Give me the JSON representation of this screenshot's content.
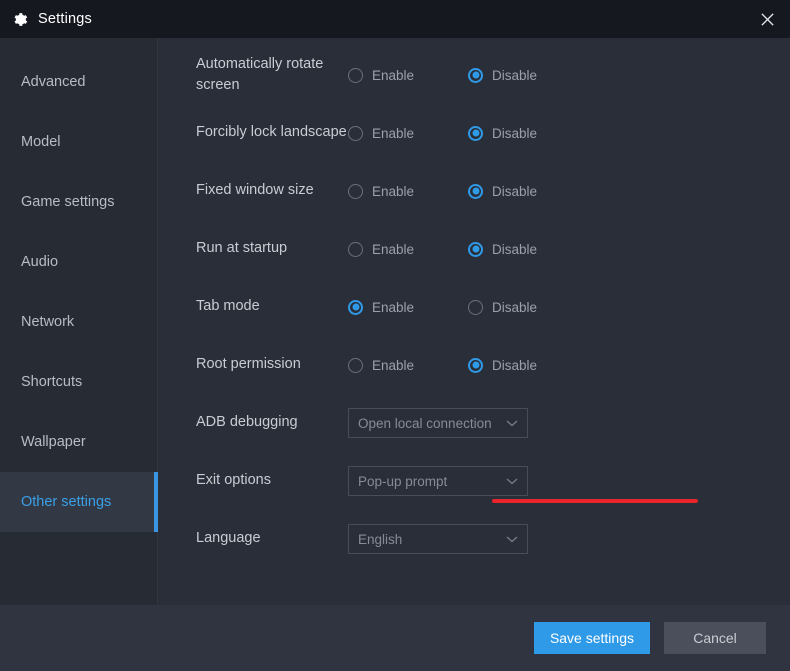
{
  "window": {
    "title": "Settings",
    "gear_icon": "gear-icon",
    "close_icon": "close-icon"
  },
  "colors": {
    "accent": "#2f9ae8",
    "selected_sidebar_text": "#3aa0e8",
    "annotation_red": "#e8242c",
    "titlebar_bg": "#15181f",
    "sidebar_bg": "#272b34",
    "content_bg": "#2a2e38",
    "footer_bg": "#2f3440"
  },
  "sidebar": {
    "items": [
      {
        "label": "Advanced",
        "selected": false
      },
      {
        "label": "Model",
        "selected": false
      },
      {
        "label": "Game settings",
        "selected": false
      },
      {
        "label": "Audio",
        "selected": false
      },
      {
        "label": "Network",
        "selected": false
      },
      {
        "label": "Shortcuts",
        "selected": false
      },
      {
        "label": "Wallpaper",
        "selected": false
      },
      {
        "label": "Other settings",
        "selected": true
      }
    ]
  },
  "main": {
    "toggle_rows": [
      {
        "label": "Automatically rotate screen",
        "enable_label": "Enable",
        "disable_label": "Disable",
        "selected": "Disable"
      },
      {
        "label": "Forcibly lock landscape",
        "enable_label": "Enable",
        "disable_label": "Disable",
        "selected": "Disable"
      },
      {
        "label": "Fixed window size",
        "enable_label": "Enable",
        "disable_label": "Disable",
        "selected": "Disable"
      },
      {
        "label": "Run at startup",
        "enable_label": "Enable",
        "disable_label": "Disable",
        "selected": "Disable"
      },
      {
        "label": "Tab mode",
        "enable_label": "Enable",
        "disable_label": "Disable",
        "selected": "Enable"
      },
      {
        "label": "Root permission",
        "enable_label": "Enable",
        "disable_label": "Disable",
        "selected": "Disable"
      }
    ],
    "select_rows": [
      {
        "label": "ADB debugging",
        "value": "Open local connection",
        "chevron_icon": "chevron-down-icon",
        "annotated": true
      },
      {
        "label": "Exit options",
        "value": "Pop-up prompt",
        "chevron_icon": "chevron-down-icon",
        "annotated": false
      },
      {
        "label": "Language",
        "value": "English",
        "chevron_icon": "chevron-down-icon",
        "annotated": false
      }
    ]
  },
  "footer": {
    "save_label": "Save settings",
    "cancel_label": "Cancel"
  }
}
